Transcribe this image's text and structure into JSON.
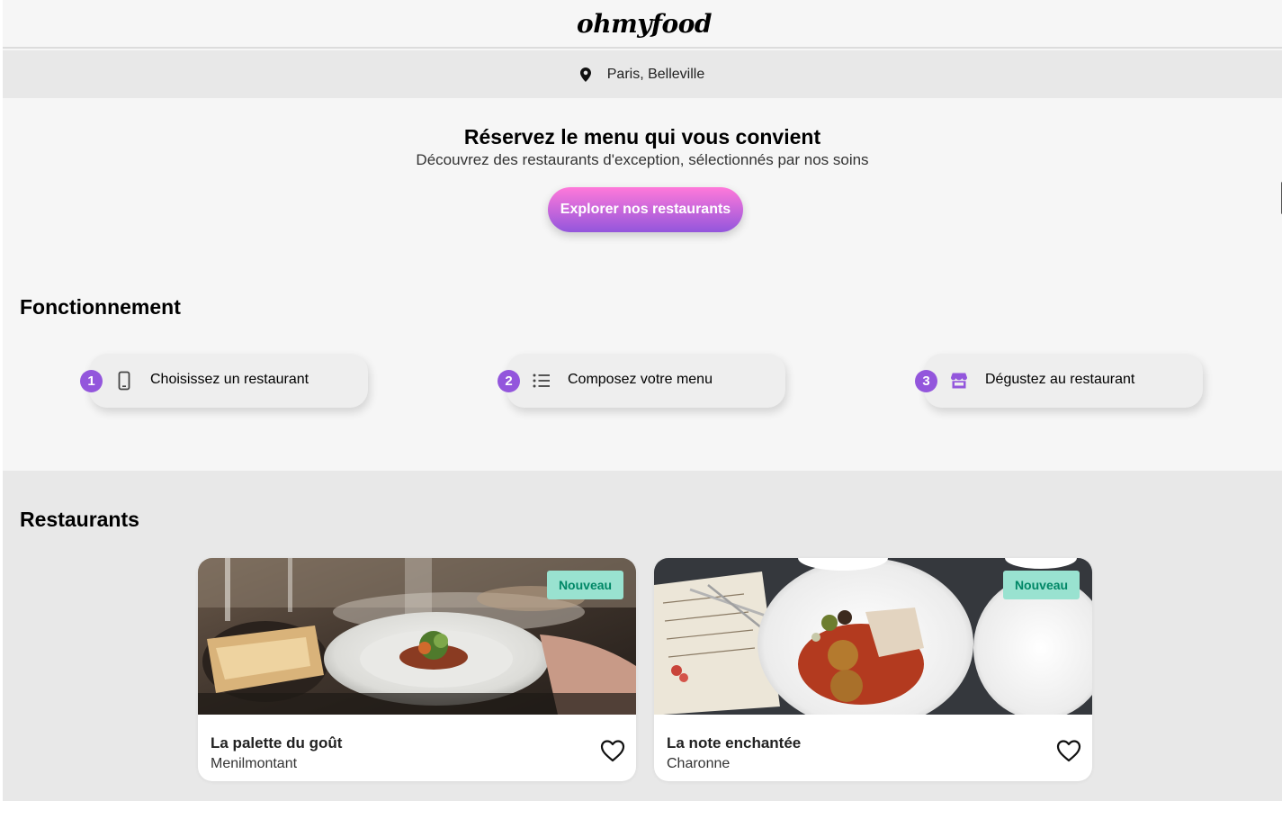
{
  "header": {
    "logo": "ohmyfood"
  },
  "location": {
    "text": "Paris, Belleville",
    "icon": "map-pin-icon"
  },
  "hero": {
    "title": "Réservez le menu qui vous convient",
    "subtitle": "Découvrez des restaurants d'exception, sélectionnés par nos soins",
    "cta_label": "Explorer nos restaurants"
  },
  "how": {
    "title": "Fonctionnement",
    "steps": [
      {
        "number": "1",
        "icon": "phone-icon",
        "label": "Choisissez un restaurant"
      },
      {
        "number": "2",
        "icon": "list-icon",
        "label": "Composez votre menu"
      },
      {
        "number": "3",
        "icon": "store-icon",
        "label": "Dégustez au restaurant"
      }
    ]
  },
  "restaurants": {
    "title": "Restaurants",
    "items": [
      {
        "name": "La palette du goût",
        "area": "Menilmontant",
        "badge": "Nouveau"
      },
      {
        "name": "La note enchantée",
        "area": "Charonne",
        "badge": "Nouveau"
      }
    ]
  },
  "colors": {
    "accent": "#9356dc",
    "cta_gradient_start": "#ff79da",
    "cta_gradient_end": "#9356dc",
    "badge_bg": "#99e2d0",
    "badge_text": "#008766"
  }
}
